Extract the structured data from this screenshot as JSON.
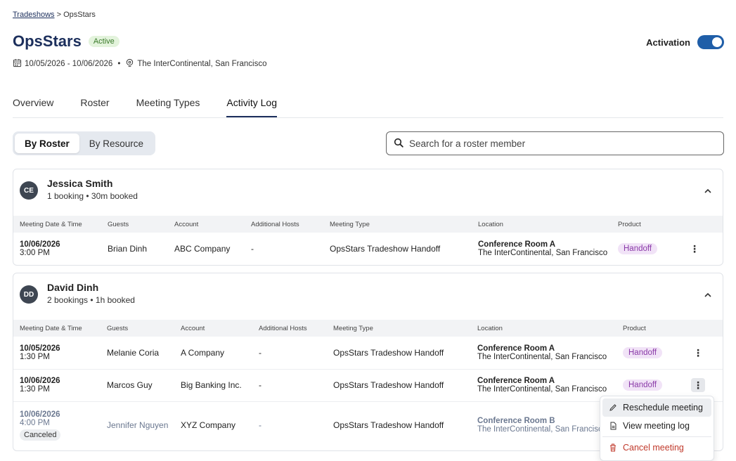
{
  "breadcrumb": {
    "root": "Tradeshows",
    "separator": ">",
    "current": "OpsStars"
  },
  "event": {
    "title": "OpsStars",
    "status": "Active",
    "dates": "10/05/2026 - 10/06/2026",
    "bullet": "•",
    "venue": "The InterContinental, San Francisco"
  },
  "activation": {
    "label": "Activation",
    "enabled": true
  },
  "tabs": [
    {
      "label": "Overview",
      "active": false
    },
    {
      "label": "Roster",
      "active": false
    },
    {
      "label": "Meeting Types",
      "active": false
    },
    {
      "label": "Activity Log",
      "active": true
    }
  ],
  "view_toggle": {
    "by_roster": "By Roster",
    "by_resource": "By Resource",
    "selected": "By Roster"
  },
  "search": {
    "placeholder": "Search for a roster member",
    "icon": "search-icon"
  },
  "columns": {
    "date_time": "Meeting Date & Time",
    "guests": "Guests",
    "account": "Account",
    "hosts": "Additional Hosts",
    "meeting_type": "Meeting Type",
    "location": "Location",
    "product": "Product"
  },
  "members": [
    {
      "initials": "CE",
      "name": "Jessica Smith",
      "summary": "1 booking • 30m booked",
      "rows": [
        {
          "date": "10/06/2026",
          "time": "3:00 PM",
          "guest": "Brian Dinh",
          "account": "ABC Company",
          "hosts": "-",
          "meeting_type": "OpsStars Tradeshow Handoff",
          "room": "Conference Room A",
          "venue": "The InterContinental, San Francisco",
          "product": "Handoff"
        }
      ]
    },
    {
      "initials": "DD",
      "name": "David Dinh",
      "summary": "2 bookings • 1h booked",
      "rows": [
        {
          "date": "10/05/2026",
          "time": "1:30 PM",
          "guest": "Melanie Coria",
          "account": "A Company",
          "hosts": "-",
          "meeting_type": "OpsStars Tradeshow Handoff",
          "room": "Conference Room A",
          "venue": "The InterContinental, San Francisco",
          "product": "Handoff"
        },
        {
          "date": "10/06/2026",
          "time": "1:30 PM",
          "guest": "Marcos Guy",
          "account": "Big Banking Inc.",
          "hosts": "-",
          "meeting_type": "OpsStars Tradeshow Handoff",
          "room": "Conference Room A",
          "venue": "The InterContinental, San Francisco",
          "product": "Handoff"
        },
        {
          "date": "10/06/2026",
          "time": "4:00 PM",
          "status": "Canceled",
          "guest": "Jennifer Nguyen",
          "account": "XYZ Company",
          "hosts": "-",
          "meeting_type": "OpsStars Tradeshow Handoff",
          "room": "Conference Room B",
          "venue": "The InterContinental, San Francisco",
          "product": ""
        }
      ]
    }
  ],
  "context_menu": {
    "reschedule": "Reschedule meeting",
    "view_log": "View meeting log",
    "cancel": "Cancel meeting"
  },
  "colors": {
    "brand_navy": "#1c2f5c",
    "toggle_blue": "#1f5ea8",
    "active_badge_bg": "#e3f3dc",
    "product_pill_bg": "#f1e3f7",
    "danger": "#c0392b"
  }
}
